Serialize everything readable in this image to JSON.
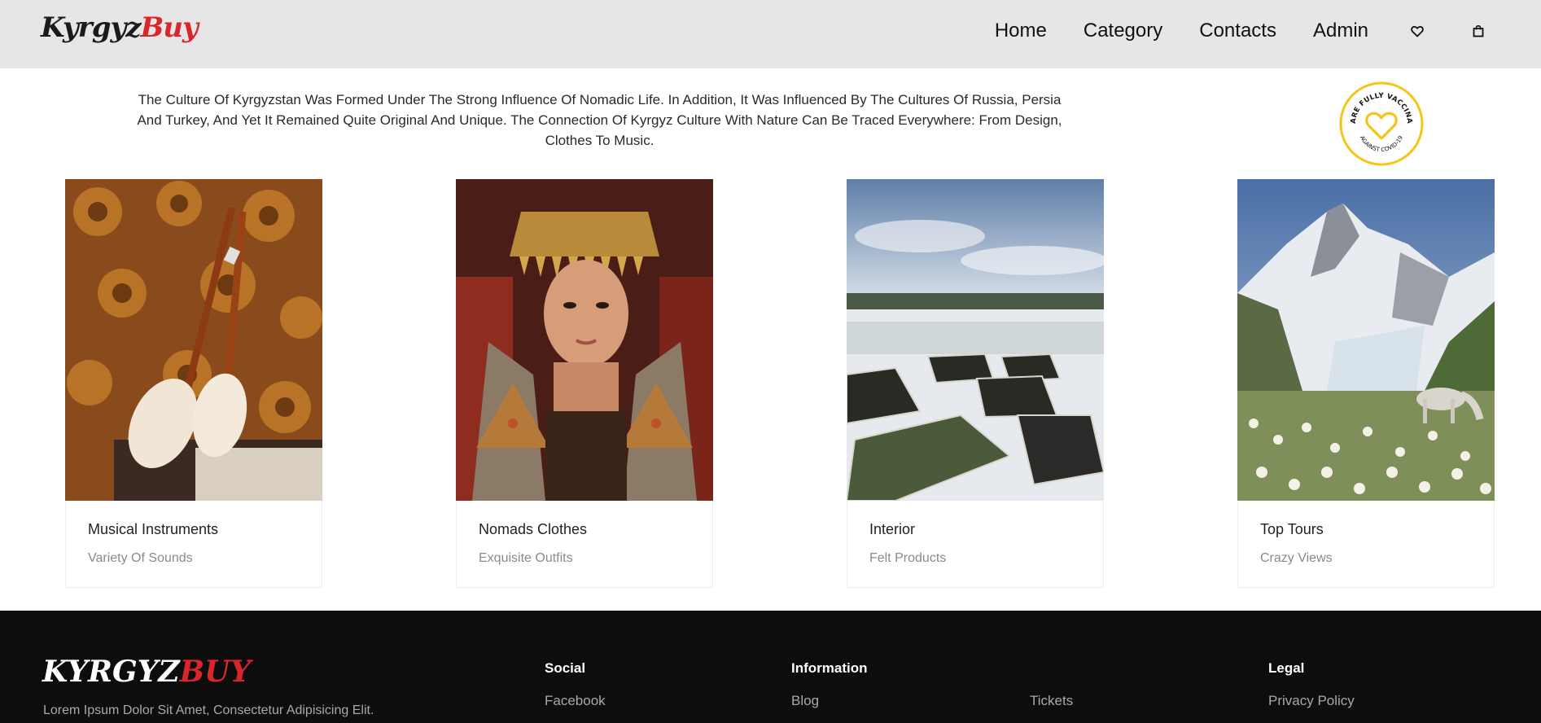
{
  "header": {
    "logo_part1": "Kyrgyz",
    "logo_part2": "Buy",
    "nav": [
      "Home",
      "Category",
      "Contacts",
      "Admin"
    ],
    "icons": [
      "heart-icon",
      "shopping-bag-icon"
    ]
  },
  "intro": {
    "text": "The Culture Of Kyrgyzstan Was Formed Under The Strong Influence Of Nomadic Life. In Addition, It Was Influenced By The Cultures Of Russia, Persia And Turkey, And Yet It Remained Quite Original And Unique. The Connection Of Kyrgyz Culture With Nature Can Be Traced Everywhere: From Design, Clothes To Music."
  },
  "badge": {
    "top_text": "WE ARE FULLY VACCINATED",
    "bottom_text": "AGAINST COVID-19",
    "accent": "#f5c518"
  },
  "cards": [
    {
      "title": "Musical Instruments",
      "subtitle": "Variety Of Sounds"
    },
    {
      "title": "Nomads Clothes",
      "subtitle": "Exquisite Outfits"
    },
    {
      "title": "Interior",
      "subtitle": "Felt Products"
    },
    {
      "title": "Top Tours",
      "subtitle": "Crazy Views"
    }
  ],
  "footer": {
    "logo_part1": "KYRGYZ",
    "logo_part2": "BUY",
    "tagline": "Lorem Ipsum Dolor Sit Amet, Consectetur Adipisicing Elit.",
    "columns": [
      {
        "heading": "Social",
        "links": [
          "Facebook"
        ]
      },
      {
        "heading": "Information",
        "links": [
          "Blog"
        ]
      },
      {
        "heading": "",
        "links": [
          "Tickets"
        ]
      },
      {
        "heading": "Legal",
        "links": [
          "Privacy Policy"
        ]
      }
    ]
  },
  "colors": {
    "brand_red": "#d8262c",
    "header_bg": "#e6e6e6",
    "footer_bg": "#0d0d0d"
  }
}
